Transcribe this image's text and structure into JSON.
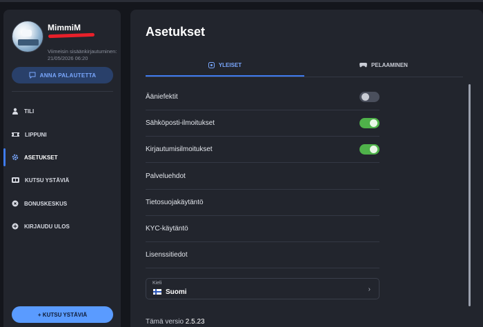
{
  "sidebar": {
    "username": "MimmiM",
    "last_login": "Viimeisin sisäänkirjautuminen: 21/05/2026 06:20",
    "feedback_label": "ANNA PALAUTETTA",
    "nav": [
      {
        "label": "TILI",
        "icon": "user-icon"
      },
      {
        "label": "LIPPUNI",
        "icon": "ticket-icon"
      },
      {
        "label": "ASETUKSET",
        "icon": "gear-icon",
        "active": true
      },
      {
        "label": "KUTSU YSTÄVIÄ",
        "icon": "invite-friends-icon"
      },
      {
        "label": "BONUSKESKUS",
        "icon": "bonus-icon"
      },
      {
        "label": "KIRJAUDU ULOS",
        "icon": "logout-icon"
      }
    ],
    "invite_button": "+ KUTSU YSTÄVIÄ"
  },
  "main": {
    "title": "Asetukset",
    "tabs": [
      {
        "label": "YLEISET",
        "icon": "general-icon",
        "active": true
      },
      {
        "label": "PELAAMINEN",
        "icon": "gamepad-icon"
      }
    ],
    "settings": [
      {
        "label": "Ääniefektit",
        "toggle": false
      },
      {
        "label": "Sähköposti-ilmoitukset",
        "toggle": true
      },
      {
        "label": "Kirjautumisilmoitukset",
        "toggle": true
      },
      {
        "label": "Palveluehdot"
      },
      {
        "label": "Tietosuojakäytäntö"
      },
      {
        "label": "KYC-käytäntö"
      },
      {
        "label": "Lisenssitiedot"
      }
    ],
    "language": {
      "label": "Kieli",
      "value": "Suomi"
    },
    "version": {
      "label": "Tämä versio",
      "value": "2.5.23"
    }
  },
  "colors": {
    "accent": "#3f7cf0",
    "toggle_on": "#4fb24a",
    "panel": "#22252d",
    "background": "#14161c"
  }
}
